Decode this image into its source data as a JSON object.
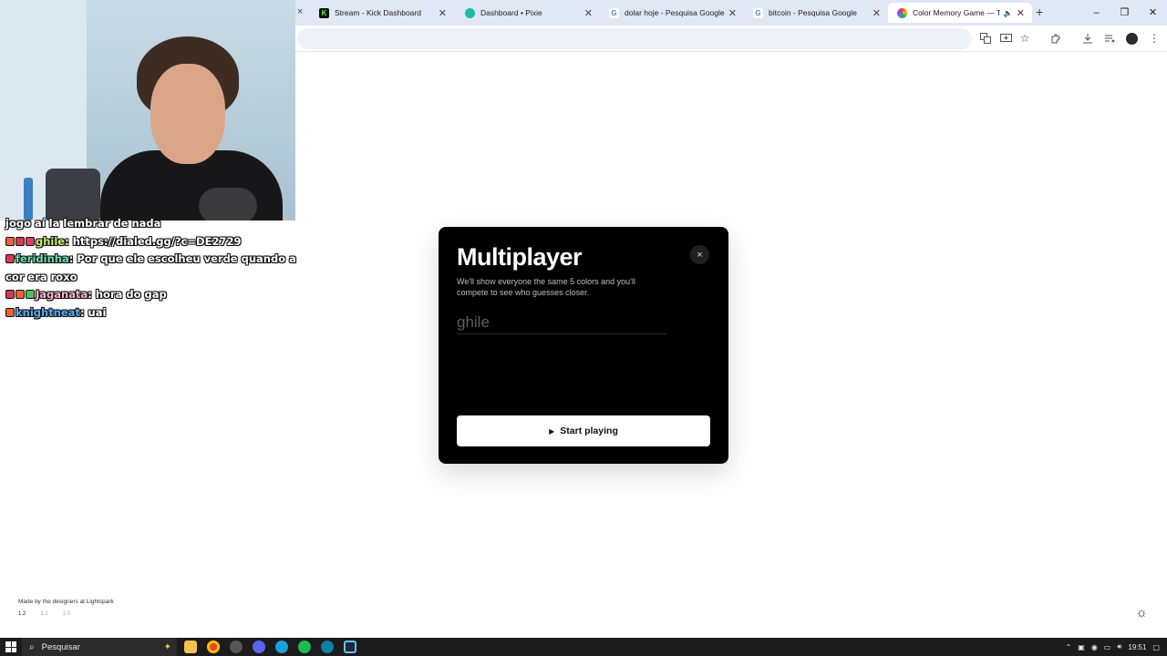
{
  "browser": {
    "tabs": [
      {
        "title": "Stream - Kick Dashboard",
        "favicon": "kick-icon"
      },
      {
        "title": "Dashboard • Pixie",
        "favicon": "pixie-icon"
      },
      {
        "title": "dolar hoje - Pesquisa Google",
        "favicon": "google-icon"
      },
      {
        "title": "bitcoin - Pesquisa Google",
        "favicon": "google-icon"
      },
      {
        "title": "Color Memory Game — Te",
        "favicon": "color-memory-icon",
        "active": true
      }
    ],
    "new_tab_icon": "+",
    "window_controls": {
      "minimize": "–",
      "restore": "❐",
      "close": "✕"
    }
  },
  "chat": {
    "messages": [
      {
        "user": "",
        "text": "jogo aí la lembrar de nada",
        "user_color": "#ffffff",
        "badges": []
      },
      {
        "user": "ghile",
        "text": "https://dialed.gg/?c=DE2729",
        "user_color": "#c6f06c",
        "badges": [
          "#e9603a",
          "#d43a4e",
          "#e43a6a"
        ]
      },
      {
        "user": "feridinha",
        "text": "Por que ele escolheu verde quando a cor era roxo",
        "user_color": "#5fe3b0",
        "badges": [
          "#d43a4e"
        ]
      },
      {
        "user": "Jaganata",
        "text": "hora do gap",
        "user_color": "#f6b2c8",
        "badges": [
          "#d43a4e",
          "#e9603a",
          "#4fbf5a"
        ]
      },
      {
        "user": "knightneat",
        "text": "uai",
        "user_color": "#5aa9f0",
        "badges": [
          "#e9603a"
        ]
      }
    ]
  },
  "modal": {
    "title": "Multiplayer",
    "description": "We'll show everyone the same 5 colors and you'll compete to see who guesses closer.",
    "name_input": {
      "placeholder": "ghile",
      "value": ""
    },
    "start_button_label": "Start playing",
    "close_icon": "×"
  },
  "footer": {
    "credit": "Made by the designers at Lightspark",
    "versions": [
      "1.2",
      "1.1",
      "1.0"
    ]
  },
  "taskbar": {
    "search_placeholder": "Pesquisar",
    "tray": {
      "time": "19:51"
    }
  },
  "colors": {
    "modal_bg": "#000000",
    "button_bg": "#ffffff",
    "page_bg": "#ffffff"
  }
}
